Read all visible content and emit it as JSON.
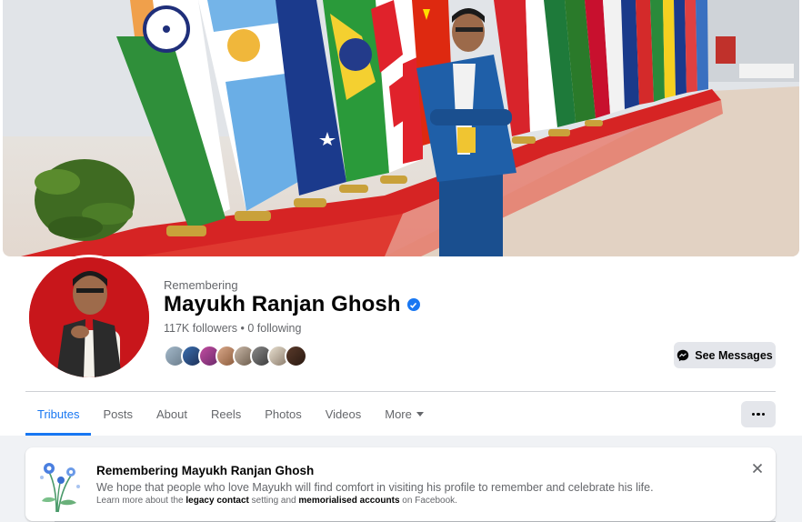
{
  "profile": {
    "memorial_label": "Remembering",
    "name": "Mayukh Ranjan Ghosh",
    "stats": "117K followers • 0 following",
    "verified_icon": "verified-badge-icon"
  },
  "actions": {
    "see_messages_label": "See Messages",
    "more_options_icon": "more-dots-icon"
  },
  "tabs": [
    {
      "label": "Tributes",
      "active": true
    },
    {
      "label": "Posts"
    },
    {
      "label": "About"
    },
    {
      "label": "Reels"
    },
    {
      "label": "Photos"
    },
    {
      "label": "Videos"
    },
    {
      "label": "More"
    }
  ],
  "memorial_notice": {
    "title": "Remembering Mayukh Ranjan Ghosh",
    "text": "We hope that people who love Mayukh will find comfort in visiting his profile to remember and celebrate his life.",
    "footnote_prefix": "Learn more about the ",
    "footnote_link1": "legacy contact",
    "footnote_middle": " setting and ",
    "footnote_link2": "memorialised accounts",
    "footnote_suffix": " on Facebook."
  },
  "colors": {
    "accent": "#1877f2",
    "button_bg": "#e4e6eb",
    "secondary_text": "#65676b",
    "page_bg": "#f0f2f5"
  }
}
